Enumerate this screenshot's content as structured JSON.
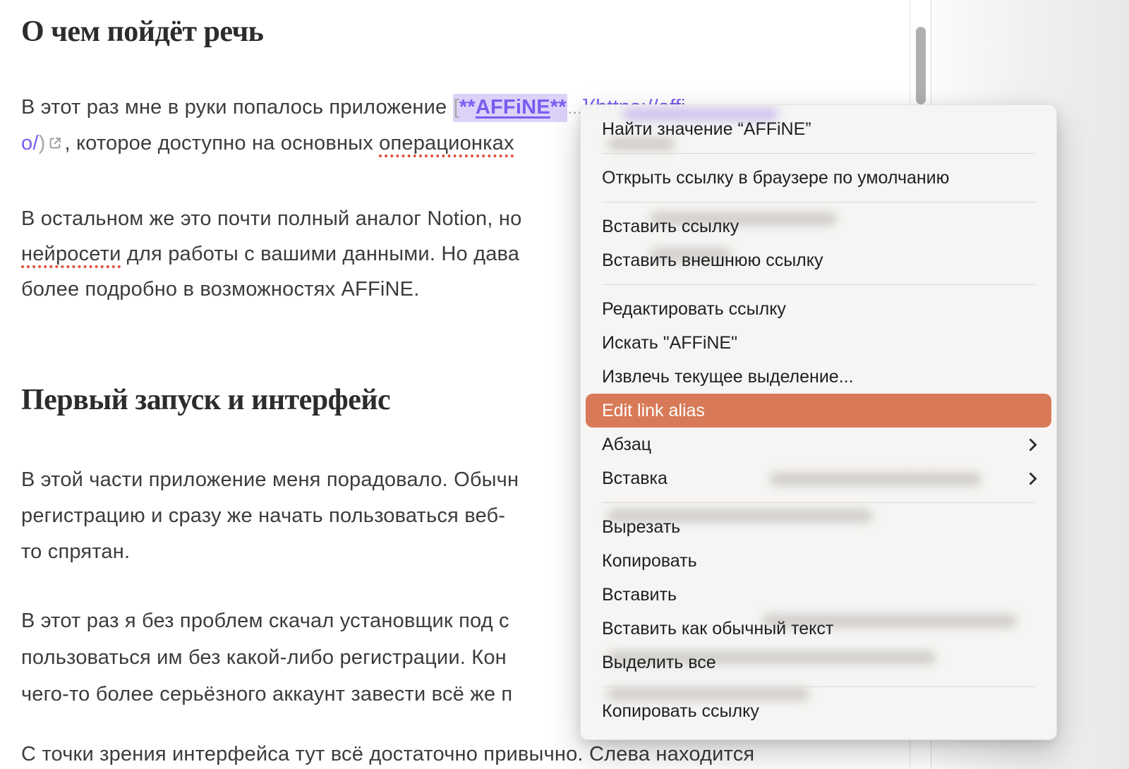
{
  "document": {
    "heading1": "О чем пойдёт речь",
    "heading2": "Первый запуск и интерфейс",
    "para1": {
      "line1_text": "В этот раз мне в руки попалось приложение ",
      "bracket_open": "[",
      "stars_open": "**",
      "link_label": "AFFiNE",
      "stars_close": "**",
      "ellipsis": "…",
      "line1_url": "](https://affi",
      "line2_url": "о/",
      "line2_paren": ")",
      "line2_text": ", которое доступно на основных ",
      "line2_misspelled": "операционках"
    },
    "para2": {
      "line1": "В остальном же это почти полный аналог Notion, но",
      "line2_misspelled": "нейросети",
      "line2_rest": " для работы с вашими данными. Но дава",
      "line3": "более подробно в возможностях AFFiNE."
    },
    "para3": {
      "line1": "В этой части приложение меня порадовало. Обычн",
      "line2": "регистрацию и сразу же начать пользоваться веб-",
      "line3": "то спрятан."
    },
    "para4": {
      "line1": "В этот раз я без проблем скачал установщик под с",
      "line2": "пользоваться им без какой-либо регистрации. Кон",
      "line3": "чего-то более серьёзного аккаунт завести всё же п"
    },
    "para5": {
      "line1": "С точки зрения интерфейса тут всё достаточно привычно. Слева находится"
    }
  },
  "context_menu": {
    "items": [
      "Найти значение “AFFiNE”",
      "Открыть ссылку в браузере по умолчанию",
      "Вставить ссылку",
      "Вставить внешнюю ссылку",
      "Редактировать ссылку",
      "Искать \"AFFiNE\"",
      "Извлечь текущее выделение...",
      "Edit link alias",
      "Абзац",
      "Вставка",
      "Вырезать",
      "Копировать",
      "Вставить",
      "Вставить как обычный текст",
      "Выделить все",
      "Копировать ссылку"
    ],
    "highlighted_item": "Edit link alias"
  },
  "colors": {
    "highlight_orange": "#d87a57",
    "link_purple": "#7b5bf0",
    "link_selection": "#dcd2f9",
    "spellcheck_red": "#e0503c",
    "menu_bg": "#f6f5f3",
    "scrollbar_thumb": "#b2b0ae"
  }
}
